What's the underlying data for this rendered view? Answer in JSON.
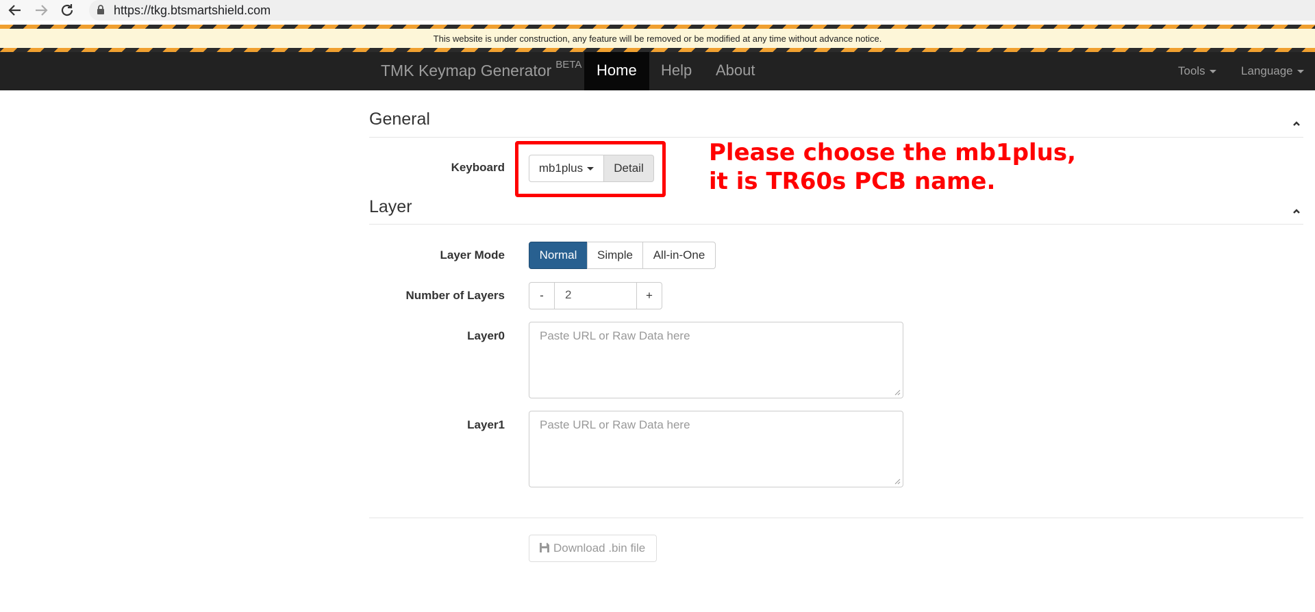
{
  "browser": {
    "url": "https://tkg.btsmartshield.com",
    "back_icon": "arrow-left-icon",
    "forward_icon": "arrow-right-icon",
    "reload_icon": "reload-icon",
    "lock_icon": "lock-icon"
  },
  "banner": {
    "text": "This website is under construction, any feature will be removed or be modified at any time without advance notice.",
    "stripe_colors": [
      "#f0a030",
      "#2b2b2b"
    ]
  },
  "navbar": {
    "brand": "TMK Keymap Generator",
    "brand_badge": "BETA",
    "links": [
      {
        "label": "Home",
        "active": true
      },
      {
        "label": "Help",
        "active": false
      },
      {
        "label": "About",
        "active": false
      }
    ],
    "tools": "Tools",
    "language": "Language"
  },
  "general": {
    "title": "General",
    "keyboard_label": "Keyboard",
    "keyboard_value": "mb1plus",
    "detail_button": "Detail"
  },
  "annotation": {
    "line1": "Please choose the mb1plus,",
    "line2": "it is TR60s PCB name.",
    "color": "#ff0000"
  },
  "layer": {
    "title": "Layer",
    "mode_label": "Layer Mode",
    "modes": [
      {
        "label": "Normal",
        "active": true
      },
      {
        "label": "Simple",
        "active": false
      },
      {
        "label": "All-in-One",
        "active": false
      }
    ],
    "count_label": "Number of Layers",
    "decrement": "-",
    "count_value": "2",
    "increment": "+",
    "layers": [
      {
        "label": "Layer0",
        "placeholder": "Paste URL or Raw Data here"
      },
      {
        "label": "Layer1",
        "placeholder": "Paste URL or Raw Data here"
      }
    ]
  },
  "download_button": "Download .bin file",
  "colors": {
    "navbar_bg": "#222222",
    "accent": "#286090"
  }
}
